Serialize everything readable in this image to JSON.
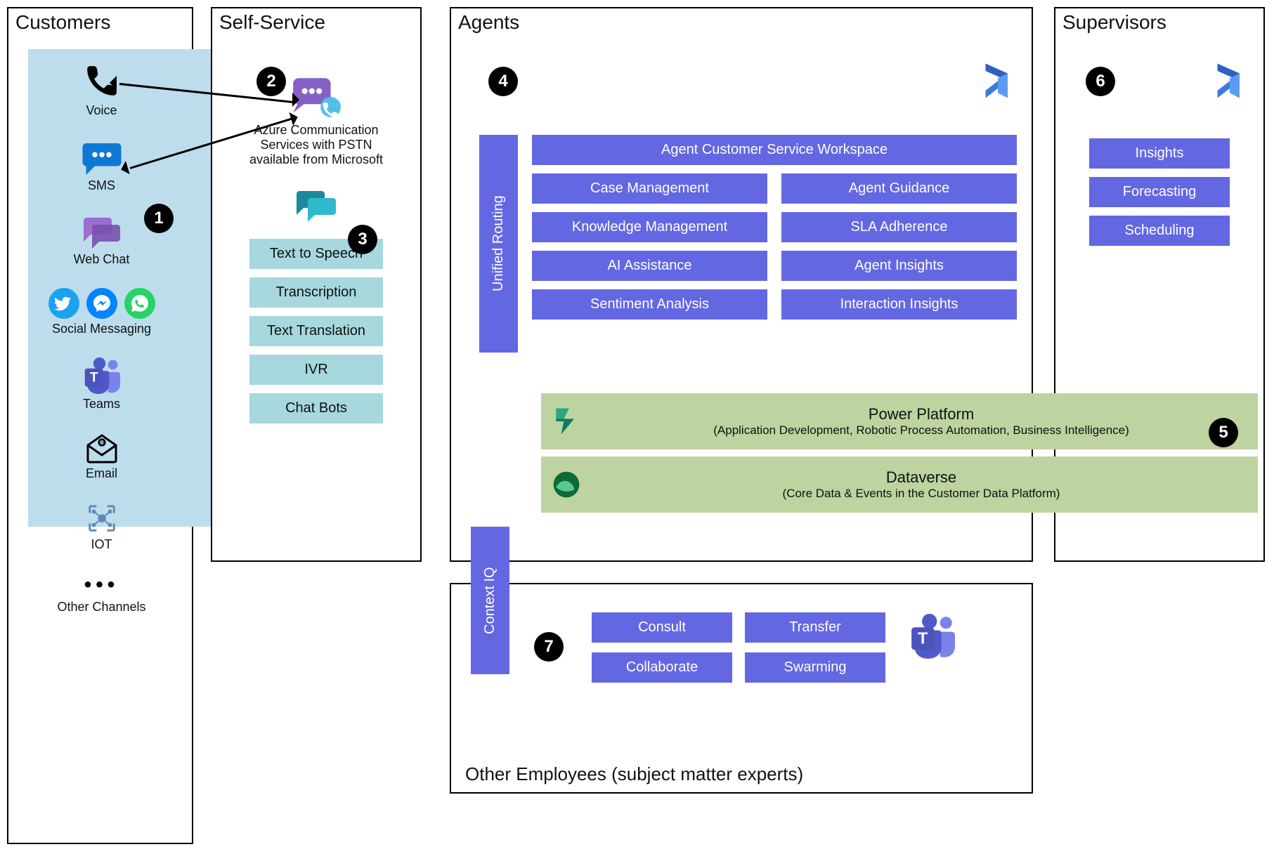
{
  "panels": {
    "customers": {
      "title": "Customers"
    },
    "selfservice": {
      "title": "Self-Service"
    },
    "agents": {
      "title": "Agents"
    },
    "supervisors": {
      "title": "Supervisors"
    },
    "otheremp": {
      "title": "Other Employees (subject matter experts)"
    }
  },
  "badges": {
    "n1": "1",
    "n2": "2",
    "n3": "3",
    "n4": "4",
    "n5": "5",
    "n6": "6",
    "n7": "7"
  },
  "customers_channels": {
    "voice": "Voice",
    "sms": "SMS",
    "webchat": "Web Chat",
    "social": "Social Messaging",
    "teams": "Teams",
    "email": "Email",
    "iot": "IOT",
    "other": "Other Channels"
  },
  "selfservice_items": {
    "acs_label": "Azure Communication Services with PSTN available from Microsoft",
    "tts": "Text to Speech",
    "transcription": "Transcription",
    "translation": "Text Translation",
    "ivr": "IVR",
    "chatbots": "Chat Bots"
  },
  "agents_items": {
    "routing": "Unified Routing",
    "workspace": "Agent Customer Service Workspace",
    "case": "Case Management",
    "guidance": "Agent Guidance",
    "knowledge": "Knowledge Management",
    "sla": "SLA Adherence",
    "ai": "AI Assistance",
    "insights": "Agent Insights",
    "sentiment": "Sentiment Analysis",
    "interaction": "Interaction Insights"
  },
  "platform": {
    "power_title": "Power Platform",
    "power_sub": "(Application Development, Robotic Process Automation, Business Intelligence)",
    "dataverse_title": "Dataverse",
    "dataverse_sub": "(Core Data & Events in the Customer Data Platform)"
  },
  "context_iq": "Context IQ",
  "otheremp_items": {
    "consult": "Consult",
    "transfer": "Transfer",
    "collab": "Collaborate",
    "swarm": "Swarming"
  },
  "supervisors_items": {
    "insights": "Insights",
    "forecasting": "Forecasting",
    "scheduling": "Scheduling"
  },
  "colors": {
    "purple": "#6467e2",
    "teal": "#a6d8dd",
    "lightblue": "#bdddec",
    "green": "#bdd3a0"
  }
}
